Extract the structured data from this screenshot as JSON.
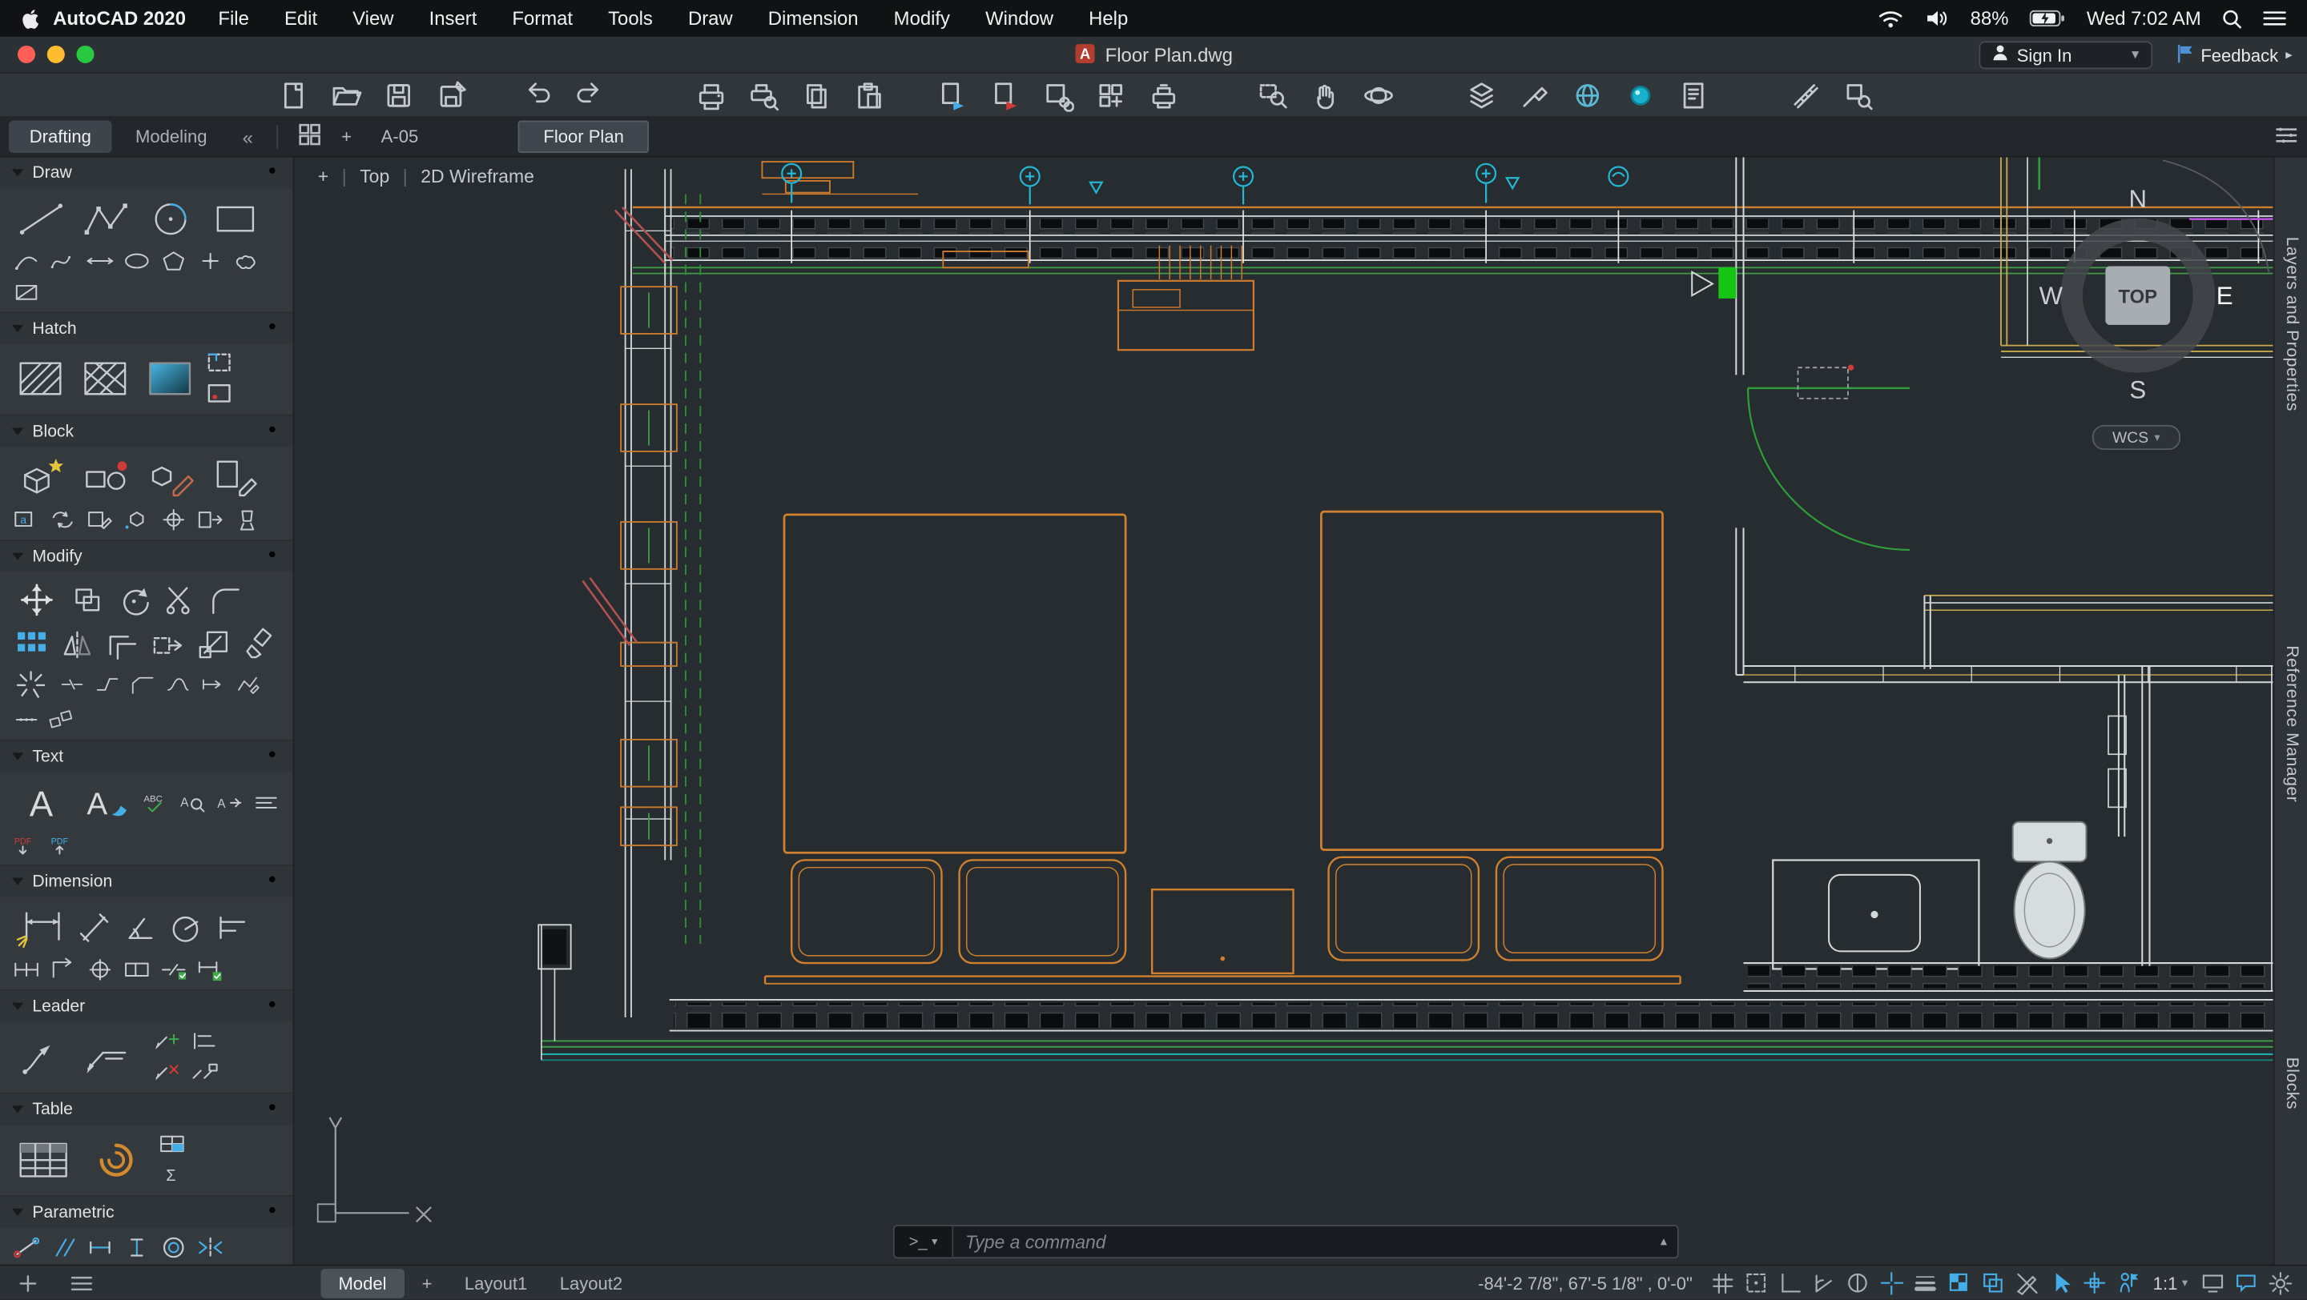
{
  "menu_bar": {
    "app_name": "AutoCAD 2020",
    "menus": [
      "File",
      "Edit",
      "View",
      "Insert",
      "Format",
      "Tools",
      "Draw",
      "Dimension",
      "Modify",
      "Window",
      "Help"
    ],
    "battery_percent": "88%",
    "clock": "Wed 7:02 AM"
  },
  "title_bar": {
    "document_title": "Floor Plan.dwg",
    "sign_in_label": "Sign In",
    "sign_in_caret": "▾",
    "feedback_label": "Feedback",
    "feedback_chevron": "▸"
  },
  "tab_bar": {
    "drafting": "Drafting",
    "modeling": "Modeling",
    "collapse": "«",
    "new_tab": "+",
    "drawing_tab": "A-05",
    "active_drawing_tab": "Floor Plan"
  },
  "viewport": {
    "plus": "+",
    "view_name": "Top",
    "visual_style": "2D Wireframe"
  },
  "viewcube": {
    "n": "N",
    "e": "E",
    "s": "S",
    "w": "W",
    "face": "TOP",
    "wcs": "WCS",
    "wcs_caret": "▾"
  },
  "side_tabs": {
    "layers": "Layers and Properties",
    "reference": "Reference Manager",
    "blocks": "Blocks"
  },
  "palette": {
    "sections": [
      {
        "title": "Draw"
      },
      {
        "title": "Hatch"
      },
      {
        "title": "Block"
      },
      {
        "title": "Modify"
      },
      {
        "title": "Text"
      },
      {
        "title": "Dimension"
      },
      {
        "title": "Leader"
      },
      {
        "title": "Table"
      },
      {
        "title": "Parametric"
      }
    ]
  },
  "command_line": {
    "prompt": ">_",
    "prompt_caret": "▾",
    "placeholder": "Type a command",
    "expand_caret": "▴"
  },
  "status_bar": {
    "model_tab": "Model",
    "add_layout": "+",
    "layout1": "Layout1",
    "layout2": "Layout2",
    "coordinates": "-84'-2 7/8\",  67'-5 1/8\" , 0'-0\"",
    "annotation_scale": "1:1",
    "scale_caret": "▾"
  },
  "colors": {
    "accent_teal": "#0696d7",
    "wall_orange": "#cf7b2e",
    "line_green": "#3f9b43",
    "line_cyan": "#22b8d4",
    "canvas_bg": "#272c30"
  }
}
